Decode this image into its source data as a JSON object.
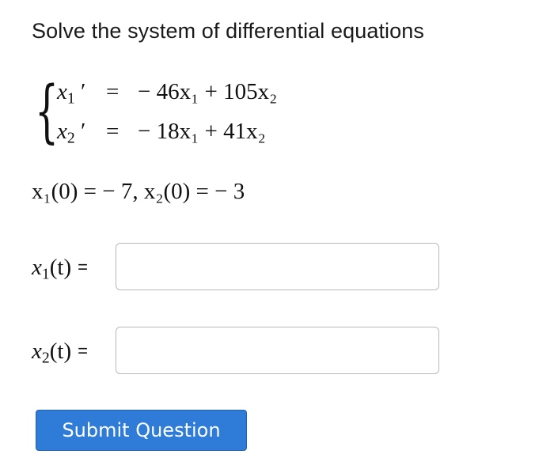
{
  "question": {
    "prompt": "Solve the system of differential equations",
    "system": [
      {
        "lhs_var": "x",
        "lhs_sub": "1",
        "prime": "′",
        "eq": "=",
        "rhs": "− 46x₁ + 105x₂"
      },
      {
        "lhs_var": "x",
        "lhs_sub": "2",
        "prime": "′",
        "eq": "=",
        "rhs": "− 18x₁ + 41x₂"
      }
    ],
    "initial_conditions": "x₁(0) = − 7,  x₂(0) = − 3"
  },
  "answers": [
    {
      "label_var": "x",
      "label_sub": "1",
      "label_arg": "(t)",
      "equals": "=",
      "value": ""
    },
    {
      "label_var": "x",
      "label_sub": "2",
      "label_arg": "(t)",
      "equals": "=",
      "value": ""
    }
  ],
  "submit_label": "Submit Question",
  "colors": {
    "button": "#2e7bd8",
    "input_border": "#b9b9b9"
  }
}
